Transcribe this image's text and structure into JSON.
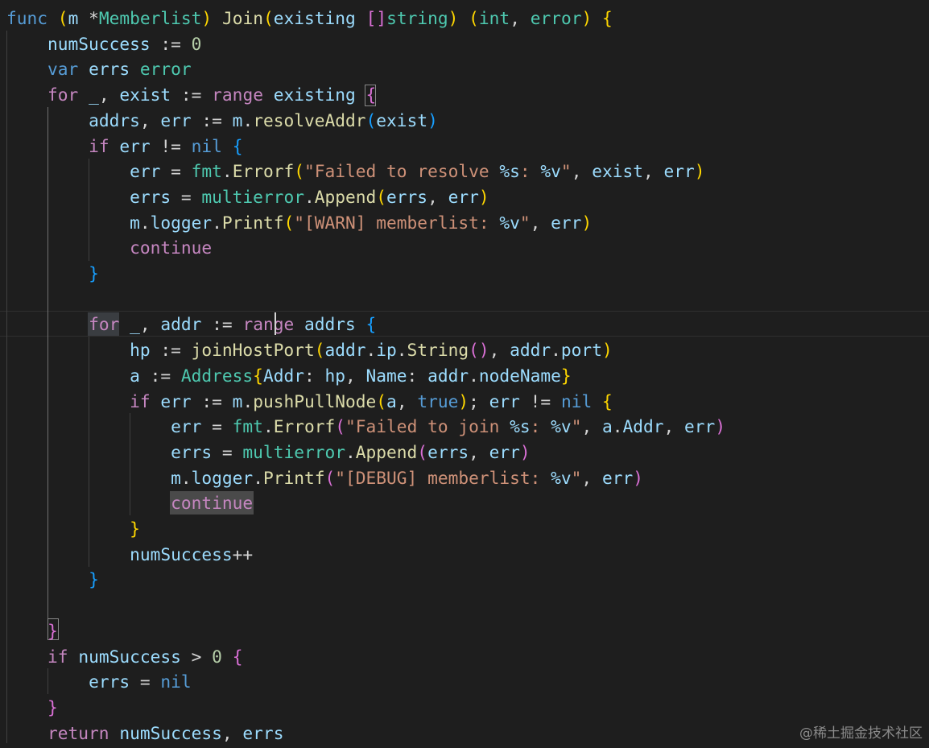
{
  "editor": {
    "theme": "dark",
    "background": "#1e1e1e",
    "current_line": 13,
    "lines": [
      [
        {
          "t": "func",
          "c": "k"
        },
        {
          "t": " "
        },
        {
          "t": "(",
          "c": "b1"
        },
        {
          "t": "m",
          "c": "v"
        },
        {
          "t": " *"
        },
        {
          "t": "Memberlist",
          "c": "t"
        },
        {
          "t": ")",
          "c": "b1"
        },
        {
          "t": " "
        },
        {
          "t": "Join",
          "c": "f"
        },
        {
          "t": "(",
          "c": "b1"
        },
        {
          "t": "existing",
          "c": "v"
        },
        {
          "t": " "
        },
        {
          "t": "[]",
          "c": "b2"
        },
        {
          "t": "string",
          "c": "t"
        },
        {
          "t": ")",
          "c": "b1"
        },
        {
          "t": " "
        },
        {
          "t": "(",
          "c": "b1"
        },
        {
          "t": "int",
          "c": "t"
        },
        {
          "t": ", "
        },
        {
          "t": "error",
          "c": "t"
        },
        {
          "t": ")",
          "c": "b1"
        },
        {
          "t": " "
        },
        {
          "t": "{",
          "c": "b1"
        }
      ],
      [
        {
          "t": "    "
        },
        {
          "t": "numSuccess",
          "c": "v"
        },
        {
          "t": " := "
        },
        {
          "t": "0",
          "c": "n"
        }
      ],
      [
        {
          "t": "    "
        },
        {
          "t": "var",
          "c": "k"
        },
        {
          "t": " "
        },
        {
          "t": "errs",
          "c": "v"
        },
        {
          "t": " "
        },
        {
          "t": "error",
          "c": "t"
        }
      ],
      [
        {
          "t": "    "
        },
        {
          "t": "for",
          "c": "kc"
        },
        {
          "t": " "
        },
        {
          "t": "_",
          "c": "v"
        },
        {
          "t": ", "
        },
        {
          "t": "exist",
          "c": "v"
        },
        {
          "t": " := "
        },
        {
          "t": "range",
          "c": "kc"
        },
        {
          "t": " "
        },
        {
          "t": "existing",
          "c": "v"
        },
        {
          "t": " "
        },
        {
          "t": "{",
          "c": "b2"
        }
      ],
      [
        {
          "t": "        "
        },
        {
          "t": "addrs",
          "c": "v"
        },
        {
          "t": ", "
        },
        {
          "t": "err",
          "c": "v"
        },
        {
          "t": " := "
        },
        {
          "t": "m",
          "c": "v"
        },
        {
          "t": "."
        },
        {
          "t": "resolveAddr",
          "c": "f"
        },
        {
          "t": "(",
          "c": "b3"
        },
        {
          "t": "exist",
          "c": "v"
        },
        {
          "t": ")",
          "c": "b3"
        }
      ],
      [
        {
          "t": "        "
        },
        {
          "t": "if",
          "c": "kc"
        },
        {
          "t": " "
        },
        {
          "t": "err",
          "c": "v"
        },
        {
          "t": " != "
        },
        {
          "t": "nil",
          "c": "k"
        },
        {
          "t": " "
        },
        {
          "t": "{",
          "c": "b3"
        }
      ],
      [
        {
          "t": "            "
        },
        {
          "t": "err",
          "c": "v"
        },
        {
          "t": " = "
        },
        {
          "t": "fmt",
          "c": "t"
        },
        {
          "t": "."
        },
        {
          "t": "Errorf",
          "c": "f"
        },
        {
          "t": "(",
          "c": "b1"
        },
        {
          "t": "\"Failed to resolve ",
          "c": "s"
        },
        {
          "t": "%s",
          "c": "fs"
        },
        {
          "t": ": ",
          "c": "s"
        },
        {
          "t": "%v",
          "c": "fs"
        },
        {
          "t": "\"",
          "c": "s"
        },
        {
          "t": ", "
        },
        {
          "t": "exist",
          "c": "v"
        },
        {
          "t": ", "
        },
        {
          "t": "err",
          "c": "v"
        },
        {
          "t": ")",
          "c": "b1"
        }
      ],
      [
        {
          "t": "            "
        },
        {
          "t": "errs",
          "c": "v"
        },
        {
          "t": " = "
        },
        {
          "t": "multierror",
          "c": "t"
        },
        {
          "t": "."
        },
        {
          "t": "Append",
          "c": "f"
        },
        {
          "t": "(",
          "c": "b1"
        },
        {
          "t": "errs",
          "c": "v"
        },
        {
          "t": ", "
        },
        {
          "t": "err",
          "c": "v"
        },
        {
          "t": ")",
          "c": "b1"
        }
      ],
      [
        {
          "t": "            "
        },
        {
          "t": "m",
          "c": "v"
        },
        {
          "t": "."
        },
        {
          "t": "logger",
          "c": "v"
        },
        {
          "t": "."
        },
        {
          "t": "Printf",
          "c": "f"
        },
        {
          "t": "(",
          "c": "b1"
        },
        {
          "t": "\"[WARN] memberlist: ",
          "c": "s"
        },
        {
          "t": "%v",
          "c": "fs"
        },
        {
          "t": "\"",
          "c": "s"
        },
        {
          "t": ", "
        },
        {
          "t": "err",
          "c": "v"
        },
        {
          "t": ")",
          "c": "b1"
        }
      ],
      [
        {
          "t": "            "
        },
        {
          "t": "continue",
          "c": "kc"
        }
      ],
      [
        {
          "t": "        "
        },
        {
          "t": "}",
          "c": "b3"
        }
      ],
      [],
      [
        {
          "t": "        "
        },
        {
          "t": "for",
          "c": "kc"
        },
        {
          "t": " "
        },
        {
          "t": "_",
          "c": "v"
        },
        {
          "t": ", "
        },
        {
          "t": "addr",
          "c": "v"
        },
        {
          "t": " := "
        },
        {
          "t": "range",
          "c": "kc"
        },
        {
          "t": " "
        },
        {
          "t": "addrs",
          "c": "v"
        },
        {
          "t": " "
        },
        {
          "t": "{",
          "c": "b3"
        }
      ],
      [
        {
          "t": "            "
        },
        {
          "t": "hp",
          "c": "v"
        },
        {
          "t": " := "
        },
        {
          "t": "joinHostPort",
          "c": "f"
        },
        {
          "t": "(",
          "c": "b1"
        },
        {
          "t": "addr",
          "c": "v"
        },
        {
          "t": "."
        },
        {
          "t": "ip",
          "c": "v"
        },
        {
          "t": "."
        },
        {
          "t": "String",
          "c": "f"
        },
        {
          "t": "()",
          "c": "b2"
        },
        {
          "t": ", "
        },
        {
          "t": "addr",
          "c": "v"
        },
        {
          "t": "."
        },
        {
          "t": "port",
          "c": "v"
        },
        {
          "t": ")",
          "c": "b1"
        }
      ],
      [
        {
          "t": "            "
        },
        {
          "t": "a",
          "c": "v"
        },
        {
          "t": " := "
        },
        {
          "t": "Address",
          "c": "t"
        },
        {
          "t": "{",
          "c": "b1"
        },
        {
          "t": "Addr",
          "c": "v"
        },
        {
          "t": ": "
        },
        {
          "t": "hp",
          "c": "v"
        },
        {
          "t": ", "
        },
        {
          "t": "Name",
          "c": "v"
        },
        {
          "t": ": "
        },
        {
          "t": "addr",
          "c": "v"
        },
        {
          "t": "."
        },
        {
          "t": "nodeName",
          "c": "v"
        },
        {
          "t": "}",
          "c": "b1"
        }
      ],
      [
        {
          "t": "            "
        },
        {
          "t": "if",
          "c": "kc"
        },
        {
          "t": " "
        },
        {
          "t": "err",
          "c": "v"
        },
        {
          "t": " := "
        },
        {
          "t": "m",
          "c": "v"
        },
        {
          "t": "."
        },
        {
          "t": "pushPullNode",
          "c": "f"
        },
        {
          "t": "(",
          "c": "b1"
        },
        {
          "t": "a",
          "c": "v"
        },
        {
          "t": ", "
        },
        {
          "t": "true",
          "c": "k"
        },
        {
          "t": ")",
          "c": "b1"
        },
        {
          "t": "; "
        },
        {
          "t": "err",
          "c": "v"
        },
        {
          "t": " != "
        },
        {
          "t": "nil",
          "c": "k"
        },
        {
          "t": " "
        },
        {
          "t": "{",
          "c": "b1"
        }
      ],
      [
        {
          "t": "                "
        },
        {
          "t": "err",
          "c": "v"
        },
        {
          "t": " = "
        },
        {
          "t": "fmt",
          "c": "t"
        },
        {
          "t": "."
        },
        {
          "t": "Errorf",
          "c": "f"
        },
        {
          "t": "(",
          "c": "b2"
        },
        {
          "t": "\"Failed to join ",
          "c": "s"
        },
        {
          "t": "%s",
          "c": "fs"
        },
        {
          "t": ": ",
          "c": "s"
        },
        {
          "t": "%v",
          "c": "fs"
        },
        {
          "t": "\"",
          "c": "s"
        },
        {
          "t": ", "
        },
        {
          "t": "a",
          "c": "v"
        },
        {
          "t": "."
        },
        {
          "t": "Addr",
          "c": "v"
        },
        {
          "t": ", "
        },
        {
          "t": "err",
          "c": "v"
        },
        {
          "t": ")",
          "c": "b2"
        }
      ],
      [
        {
          "t": "                "
        },
        {
          "t": "errs",
          "c": "v"
        },
        {
          "t": " = "
        },
        {
          "t": "multierror",
          "c": "t"
        },
        {
          "t": "."
        },
        {
          "t": "Append",
          "c": "f"
        },
        {
          "t": "(",
          "c": "b2"
        },
        {
          "t": "errs",
          "c": "v"
        },
        {
          "t": ", "
        },
        {
          "t": "err",
          "c": "v"
        },
        {
          "t": ")",
          "c": "b2"
        }
      ],
      [
        {
          "t": "                "
        },
        {
          "t": "m",
          "c": "v"
        },
        {
          "t": "."
        },
        {
          "t": "logger",
          "c": "v"
        },
        {
          "t": "."
        },
        {
          "t": "Printf",
          "c": "f"
        },
        {
          "t": "(",
          "c": "b2"
        },
        {
          "t": "\"[DEBUG] memberlist: ",
          "c": "s"
        },
        {
          "t": "%v",
          "c": "fs"
        },
        {
          "t": "\"",
          "c": "s"
        },
        {
          "t": ", "
        },
        {
          "t": "err",
          "c": "v"
        },
        {
          "t": ")",
          "c": "b2"
        }
      ],
      [
        {
          "t": "                "
        },
        {
          "t": "continue",
          "c": "kc"
        }
      ],
      [
        {
          "t": "            "
        },
        {
          "t": "}",
          "c": "b1"
        }
      ],
      [
        {
          "t": "            "
        },
        {
          "t": "numSuccess",
          "c": "v"
        },
        {
          "t": "++"
        }
      ],
      [
        {
          "t": "        "
        },
        {
          "t": "}",
          "c": "b3"
        }
      ],
      [],
      [
        {
          "t": "    "
        },
        {
          "t": "}",
          "c": "b2"
        }
      ],
      [
        {
          "t": "    "
        },
        {
          "t": "if",
          "c": "kc"
        },
        {
          "t": " "
        },
        {
          "t": "numSuccess",
          "c": "v"
        },
        {
          "t": " > "
        },
        {
          "t": "0",
          "c": "n"
        },
        {
          "t": " "
        },
        {
          "t": "{",
          "c": "b2"
        }
      ],
      [
        {
          "t": "        "
        },
        {
          "t": "errs",
          "c": "v"
        },
        {
          "t": " = "
        },
        {
          "t": "nil",
          "c": "k"
        }
      ],
      [
        {
          "t": "    "
        },
        {
          "t": "}",
          "c": "b2"
        }
      ],
      [
        {
          "t": "    "
        },
        {
          "t": "return",
          "c": "kc"
        },
        {
          "t": " "
        },
        {
          "t": "numSuccess",
          "c": "v"
        },
        {
          "t": ", "
        },
        {
          "t": "errs",
          "c": "v"
        }
      ]
    ]
  },
  "watermark": "@稀土掘金技术社区"
}
